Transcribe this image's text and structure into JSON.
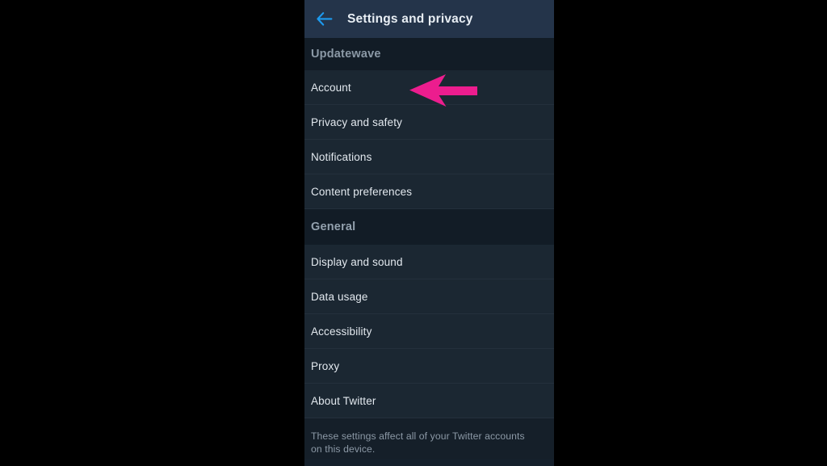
{
  "toolbar": {
    "back_icon": "arrow-left-icon",
    "back_icon_color": "#1d9bf0",
    "title": "Settings and privacy"
  },
  "sections": [
    {
      "header": "Updatewave",
      "items": [
        {
          "label": "Account"
        },
        {
          "label": "Privacy and safety"
        },
        {
          "label": "Notifications"
        },
        {
          "label": "Content preferences"
        }
      ]
    },
    {
      "header": "General",
      "items": [
        {
          "label": "Display and sound"
        },
        {
          "label": "Data usage"
        },
        {
          "label": "Accessibility"
        },
        {
          "label": "Proxy"
        },
        {
          "label": "About Twitter"
        }
      ]
    }
  ],
  "footer": {
    "note": "These settings affect all of your Twitter accounts on this device."
  },
  "annotation": {
    "icon": "arrow-left-annotation",
    "color": "#ec1d8e",
    "points_at": "Account"
  },
  "theme": {
    "background": "#000000",
    "panel": "#15202b",
    "toolbar_bg": "#24344a",
    "section_header_bg": "#121c26",
    "row_bg": "#1b2732",
    "divider": "#24303c",
    "primary_text": "#e3e9ef",
    "secondary_text": "#8c99a6",
    "accent": "#1d9bf0"
  }
}
